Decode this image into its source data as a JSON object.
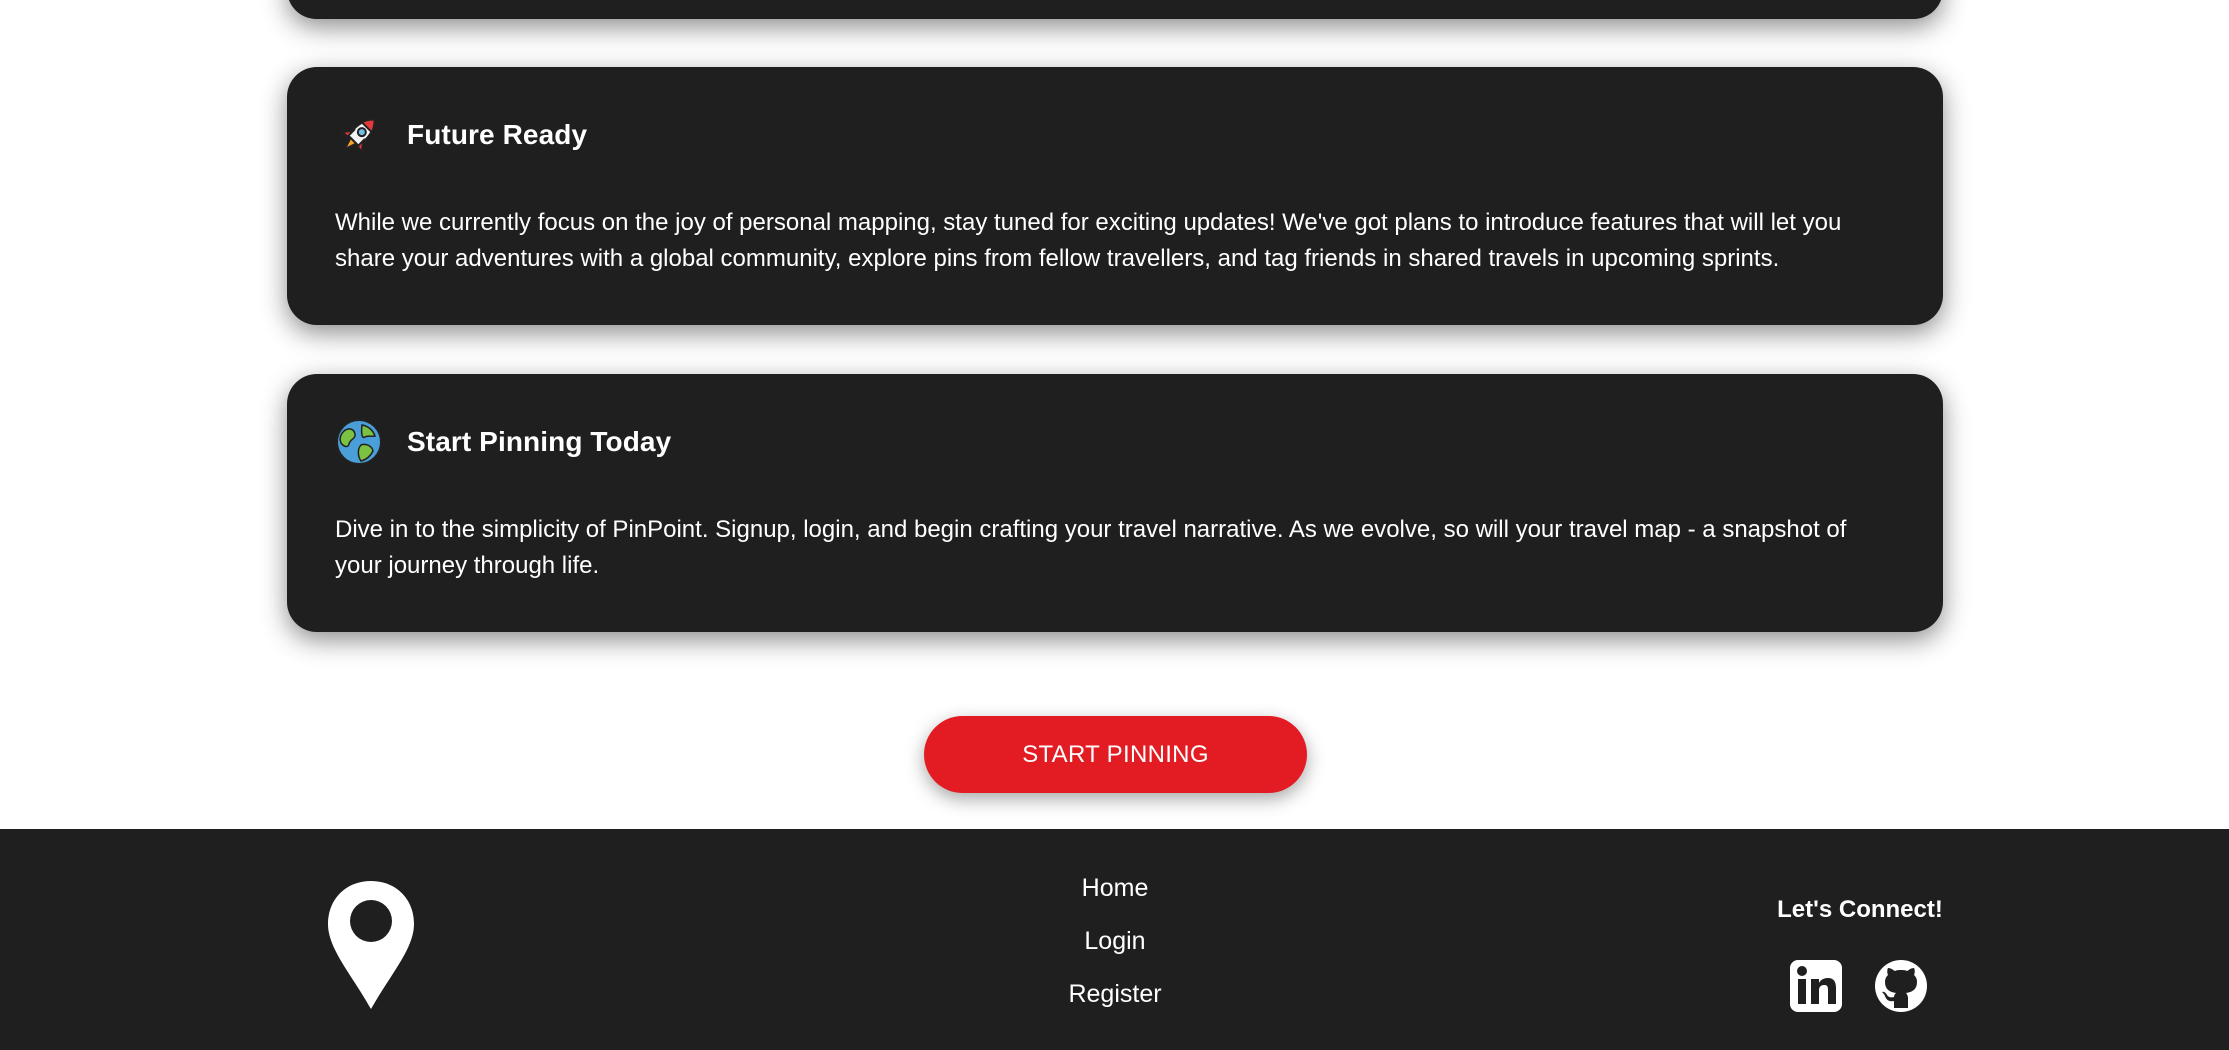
{
  "cards": [
    {
      "icon": "rocket-icon",
      "title": "Future Ready",
      "body": "While we currently focus on the joy of personal mapping, stay tuned for exciting updates! We've got plans to introduce features that will let you share your adventures with a global community, explore pins from fellow travellers, and tag friends in shared travels in upcoming sprints."
    },
    {
      "icon": "globe-icon",
      "title": "Start Pinning Today",
      "body": "Dive in to the simplicity of PinPoint. Signup, login, and begin crafting your travel narrative. As we evolve, so will your travel map - a snapshot of your journey through life."
    }
  ],
  "cta": {
    "label": "START PINNING",
    "color": "#e31b23"
  },
  "footer": {
    "logo_icon": "map-pin-icon",
    "nav": [
      "Home",
      "Login",
      "Register"
    ],
    "connect_title": "Let's Connect!",
    "social_icons": [
      "linkedin-icon",
      "github-icon"
    ]
  },
  "colors": {
    "card_background": "#1f1f1f",
    "footer_background": "#1f1f1f",
    "accent": "#e31b23",
    "text": "#ffffff"
  }
}
